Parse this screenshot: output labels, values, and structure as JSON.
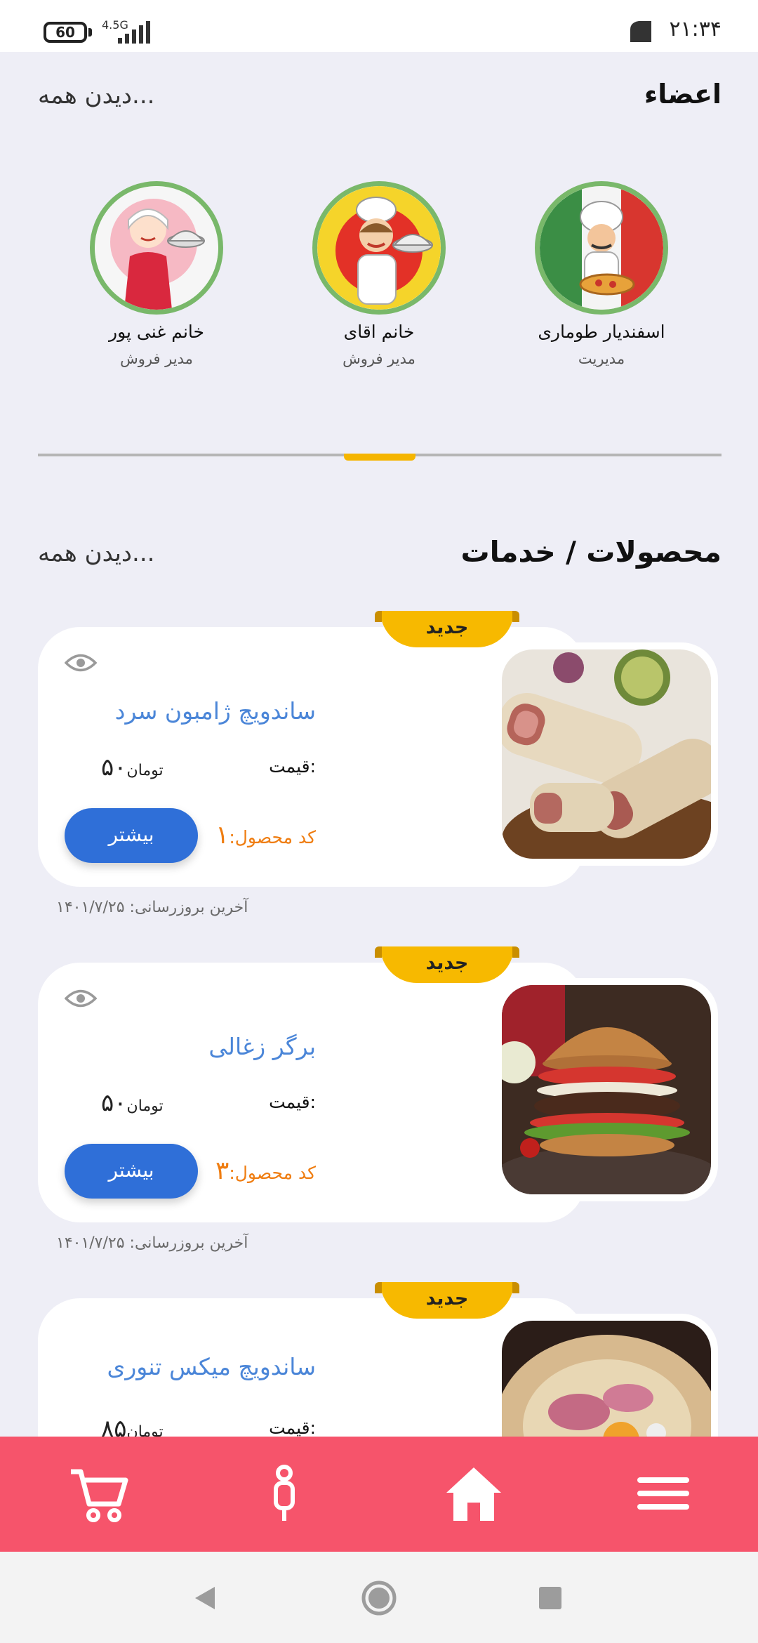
{
  "status_bar": {
    "battery": "60",
    "network": "4.5G",
    "time": "۲۱:۳۴"
  },
  "members_section": {
    "title": "اعضاء",
    "see_all": "دیدن همه...",
    "members": [
      {
        "name": "اسفندیار طوماری",
        "role": "مدیریت",
        "icon": "chef-pizza-avatar"
      },
      {
        "name": "خانم اقای",
        "role": "مدیر فروش",
        "icon": "female-chef-avatar"
      },
      {
        "name": "خانم غنی پور",
        "role": "مدیر فروش",
        "icon": "waitress-avatar"
      }
    ]
  },
  "products_section": {
    "title": "محصولات / خدمات",
    "see_all": "دیدن همه...",
    "products": [
      {
        "badge": "جدید",
        "name": "ساندویچ ژامبون سرد",
        "price_label": "قیمت:",
        "price_value": "۵۰",
        "currency": "تومان",
        "code_label": "کد محصول:",
        "code_value": "۱",
        "button": "بیشتر",
        "updated": "آخرین بروزرسانی: ۱۴۰۱/۷/۲۵",
        "image": "wrap-sandwich-photo"
      },
      {
        "badge": "جدید",
        "name": "برگر زغالی",
        "price_label": "قیمت:",
        "price_value": "۵۰",
        "currency": "تومان",
        "code_label": "کد محصول:",
        "code_value": "۳",
        "button": "بیشتر",
        "updated": "آخرین بروزرسانی: ۱۴۰۱/۷/۲۵",
        "image": "burger-photo"
      },
      {
        "badge": "جدید",
        "name": "ساندویچ میکس تنوری",
        "price_label": "قیمت:",
        "price_value": "۸۵",
        "currency": "تومان",
        "image": "mixed-sandwich-photo"
      }
    ]
  },
  "bottom_nav": {
    "items": [
      "cart-icon",
      "profile-icon",
      "home-icon",
      "menu-icon"
    ],
    "color": "#f6546b"
  },
  "colors": {
    "accent": "#2f6fd8",
    "badge": "#f7b900",
    "product_name": "#4b86d8",
    "code": "#ef7d11",
    "avatar_ring": "#79b86a"
  }
}
